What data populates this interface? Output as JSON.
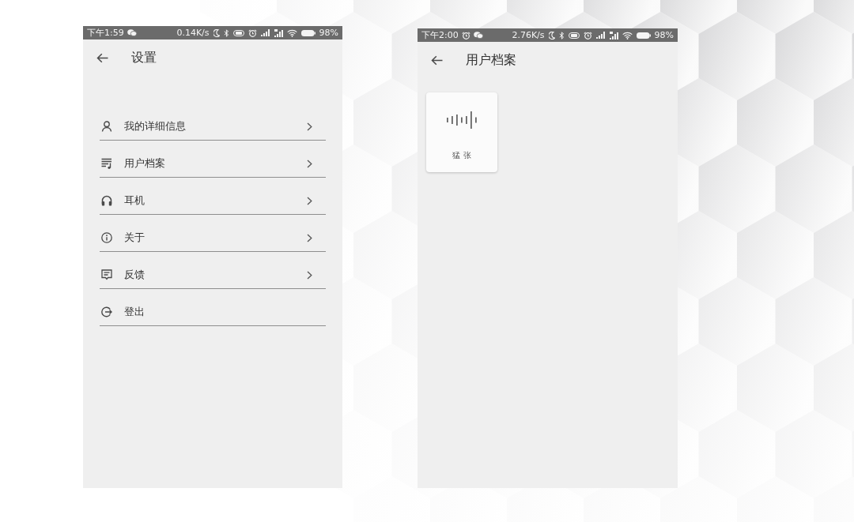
{
  "screens": [
    {
      "status_bar": {
        "time": "下午1:59",
        "net_speed": "0.14K/s",
        "battery": "98%"
      },
      "app_bar": {
        "title": "设置"
      },
      "menu": [
        {
          "label": "我的详细信息",
          "chevron": true
        },
        {
          "label": "用户档案",
          "chevron": true
        },
        {
          "label": "耳机",
          "chevron": true
        },
        {
          "label": "关于",
          "chevron": true
        },
        {
          "label": "反馈",
          "chevron": true
        },
        {
          "label": "登出",
          "chevron": false
        }
      ]
    },
    {
      "status_bar": {
        "time": "下午2:00",
        "net_speed": "2.76K/s",
        "battery": "98%"
      },
      "app_bar": {
        "title": "用户档案"
      },
      "profiles": [
        {
          "name": "猛 张"
        }
      ]
    }
  ]
}
